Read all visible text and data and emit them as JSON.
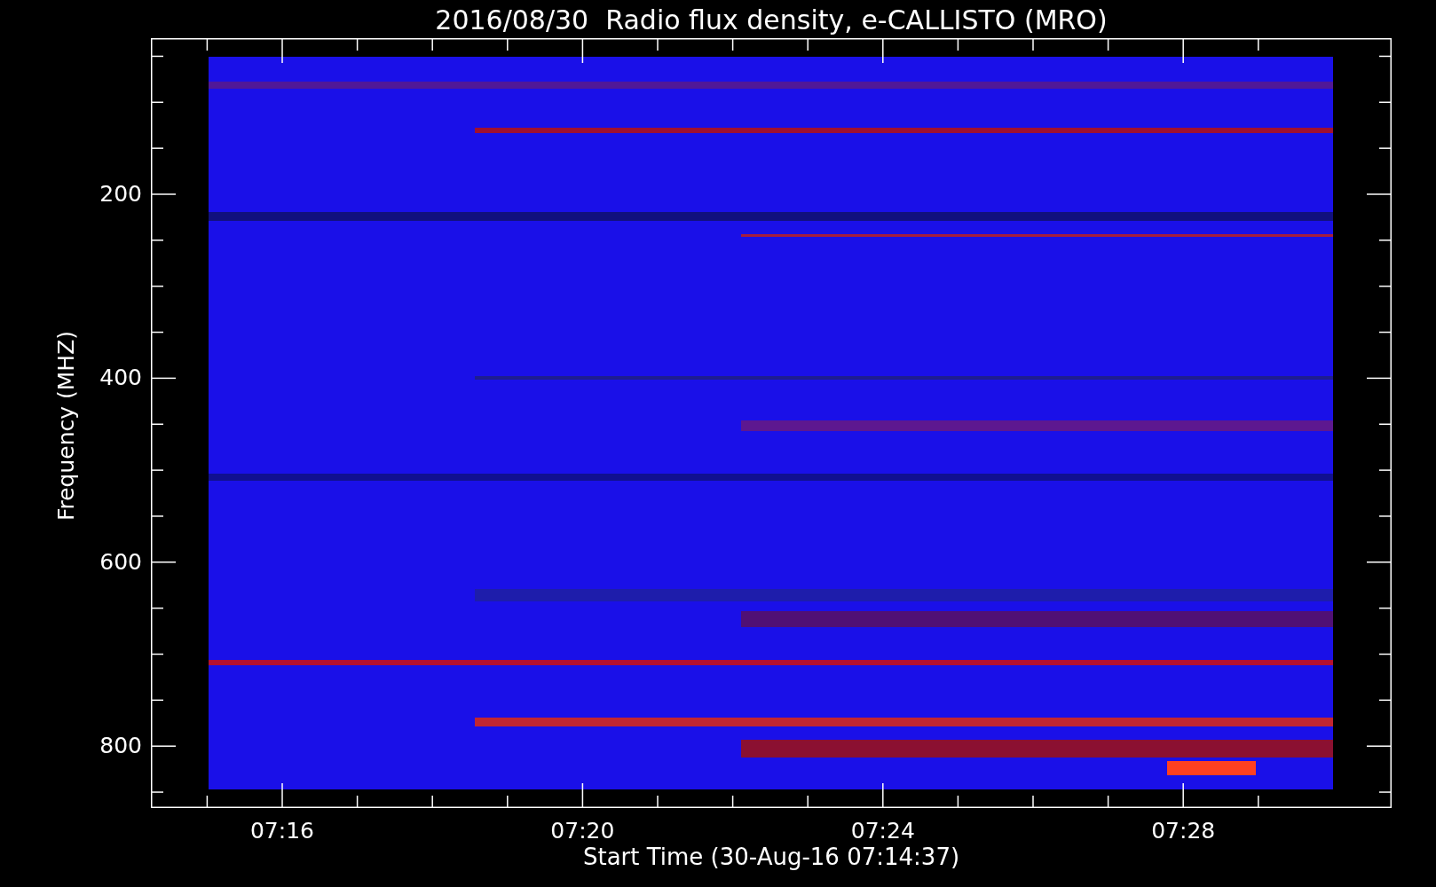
{
  "plot": {
    "title": "2016/08/30  Radio flux density, e-CALLISTO (MRO)",
    "ylabel": "Frequency (MHZ)",
    "yticks": [
      "200",
      "400",
      "600",
      "800"
    ],
    "xticks": [
      "07:16",
      "07:20",
      "07:24",
      "07:28"
    ],
    "xlabel": "Start Time (30-Aug-16 07:14:37)"
  }
}
